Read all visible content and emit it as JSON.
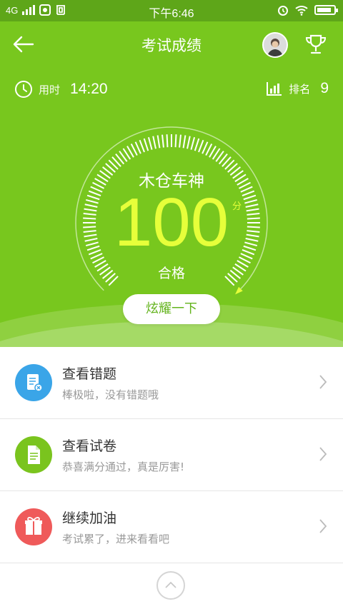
{
  "status_bar": {
    "network": "4G",
    "time": "下午6:46",
    "battery_level": 0.85
  },
  "header": {
    "title": "考试成绩",
    "back_icon": "back-arrow-icon",
    "trophy_icon": "trophy-icon"
  },
  "stats": {
    "time_label": "用时",
    "time_value": "14:20",
    "rank_label": "排名",
    "rank_value": "9"
  },
  "score": {
    "title": "木仓车神",
    "value": "100",
    "unit": "分",
    "status": "合格",
    "fraction": 1.0
  },
  "share_button": {
    "label": "炫耀一下"
  },
  "actions": [
    {
      "title": "查看错题",
      "subtitle": "棒极啦，没有错题哦",
      "icon": "wrong-questions-icon",
      "color": "#3aa5e8"
    },
    {
      "title": "查看试卷",
      "subtitle": "恭喜满分通过，真是厉害!",
      "icon": "exam-paper-icon",
      "color": "#7ac41e"
    },
    {
      "title": "继续加油",
      "subtitle": "考试累了，进来看看吧",
      "icon": "gift-icon",
      "color": "#ef5a5a"
    }
  ],
  "colors": {
    "primary_green": "#78c71e",
    "score_yellow": "#e6ff3a"
  }
}
